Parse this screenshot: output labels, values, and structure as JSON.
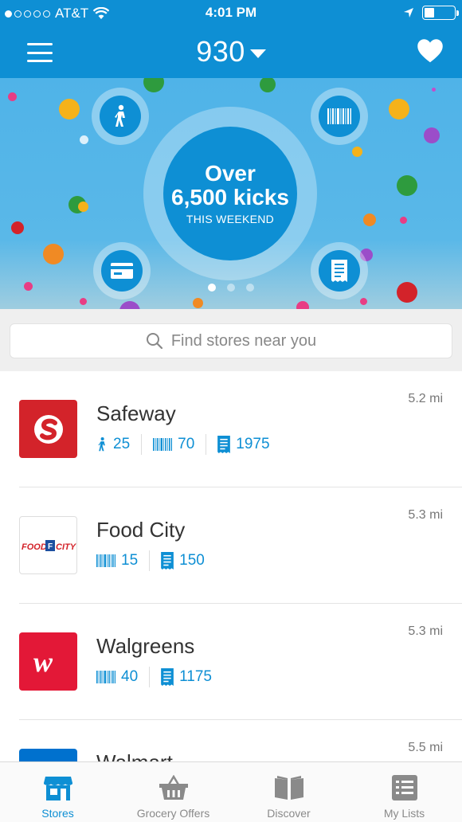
{
  "status_bar": {
    "carrier": "AT&T",
    "time": "4:01 PM"
  },
  "header": {
    "points": "930"
  },
  "banner": {
    "line1": "Over",
    "line2": "6,500 kicks",
    "line3": "THIS WEEKEND",
    "pages": 3,
    "active_page": 0
  },
  "search": {
    "placeholder": "Find stores near you"
  },
  "stores": [
    {
      "name": "Safeway",
      "distance": "5.2 mi",
      "walkin": "25",
      "scan": "70",
      "receipt": "1975"
    },
    {
      "name": "Food City",
      "distance": "5.3 mi",
      "scan": "15",
      "receipt": "150"
    },
    {
      "name": "Walgreens",
      "distance": "5.3 mi",
      "scan": "40",
      "receipt": "1175"
    },
    {
      "name": "Walmart",
      "distance": "5.5 mi"
    }
  ],
  "food_city_logo_text": "FOOD CITY",
  "tabs": [
    {
      "label": "Stores"
    },
    {
      "label": "Grocery Offers"
    },
    {
      "label": "Discover"
    },
    {
      "label": "My Lists"
    }
  ],
  "colors": {
    "brand": "#0e8fd4",
    "safeway": "#d3232a",
    "walgreens": "#e31837",
    "walmart": "#0071ce"
  }
}
